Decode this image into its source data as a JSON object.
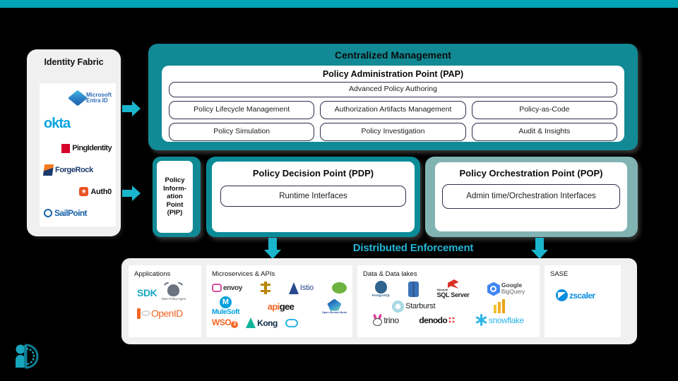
{
  "theme": {
    "accent_teal": "#00A5B5",
    "panel_teal": "#118a95",
    "pdp_teal": "#0a8c98",
    "pop_sage": "#82b3b3",
    "arrow_cyan": "#22b4d4",
    "panel_gray": "#f0f0f0",
    "background": "#000000"
  },
  "identity_fabric": {
    "title": "Identity Fabric",
    "vendors": [
      {
        "name": "Microsoft Entra ID",
        "line1": "Microsoft",
        "line2": "Entra ID",
        "icon": "microsoft-entra-id-logo"
      },
      {
        "name": "Okta",
        "label": "okta",
        "icon": "okta-logo"
      },
      {
        "name": "Ping Identity",
        "label": "PingIdentity",
        "icon": "ping-identity-logo"
      },
      {
        "name": "ForgeRock",
        "label": "ForgeRock",
        "icon": "forgerock-logo"
      },
      {
        "name": "Auth0",
        "label": "Auth0",
        "icon": "auth0-logo"
      },
      {
        "name": "SailPoint",
        "label": "SailPoint",
        "icon": "sailpoint-logo"
      }
    ]
  },
  "centralized_management": {
    "title": "Centralized Management",
    "pap": {
      "title": "Policy Administration Point (PAP)",
      "wide_item": "Advanced Policy Authoring",
      "row1": [
        "Policy Lifecycle Management",
        "Authorization Artifacts Management",
        "Policy-as-Code"
      ],
      "row2": [
        "Policy Simulation",
        "Policy Investigation",
        "Audit & Insights"
      ]
    }
  },
  "pip": {
    "title": "Policy Inform-\nation Point (PIP)",
    "lines": [
      "Policy",
      "Inform-",
      "ation",
      "Point",
      "(PIP)"
    ]
  },
  "pdp": {
    "title": "Policy Decision Point (PDP)",
    "interface": "Runtime Interfaces"
  },
  "pop": {
    "title": "Policy Orchestration Point (POP)",
    "interface": "Admin time/Orchestration Interfaces"
  },
  "distributed_enforcement": {
    "title": "Distributed Enforcement",
    "panels": [
      {
        "label": "Applications",
        "logos": [
          {
            "name": "SDK",
            "text": "SDK"
          },
          {
            "name": "Open Policy Agent",
            "caption": "Open Policy Agent"
          },
          {
            "name": "OpenID",
            "text": "OpenID"
          }
        ]
      },
      {
        "label": "Microservices & APIs",
        "logos": [
          {
            "name": "Envoy",
            "text": "envoy"
          },
          {
            "name": "AWS App Mesh"
          },
          {
            "name": "Istio",
            "text": "Istio"
          },
          {
            "name": "Spring"
          },
          {
            "name": "MuleSoft",
            "text": "MuleSoft"
          },
          {
            "name": "Apigee",
            "text": "apigee"
          },
          {
            "name": "WSO2",
            "text": "WSO2"
          },
          {
            "name": "Kong",
            "text": "Kong"
          },
          {
            "name": "Salesforce Cloud"
          },
          {
            "name": "Open Service Mesh",
            "caption": "Open Service Mesh"
          }
        ]
      },
      {
        "label": "Data & Data lakes",
        "logos": [
          {
            "name": "PostgreSQL",
            "caption": "PostgreSQL"
          },
          {
            "name": "Amazon Redshift"
          },
          {
            "name": "Microsoft SQL Server",
            "text": "SQL Server",
            "sup": "Microsoft"
          },
          {
            "name": "Google BigQuery",
            "line1": "Google",
            "line2": "BigQuery"
          },
          {
            "name": "Starburst",
            "text": "Starburst"
          },
          {
            "name": "Power BI"
          },
          {
            "name": "Trino",
            "text": "trino"
          },
          {
            "name": "Denodo",
            "text": "denodo"
          },
          {
            "name": "Snowflake",
            "text": "snowflake"
          }
        ]
      },
      {
        "label": "SASE",
        "logos": [
          {
            "name": "Zscaler",
            "text": "zscaler"
          }
        ]
      }
    ]
  },
  "arrows": {
    "identity_to_pap": "arrow-right-icon",
    "identity_to_pip": "arrow-right-icon",
    "pdp_to_enforcement": "arrow-down-icon",
    "pop_to_enforcement": "arrow-down-icon"
  },
  "brand": {
    "name": "identity-logo"
  }
}
